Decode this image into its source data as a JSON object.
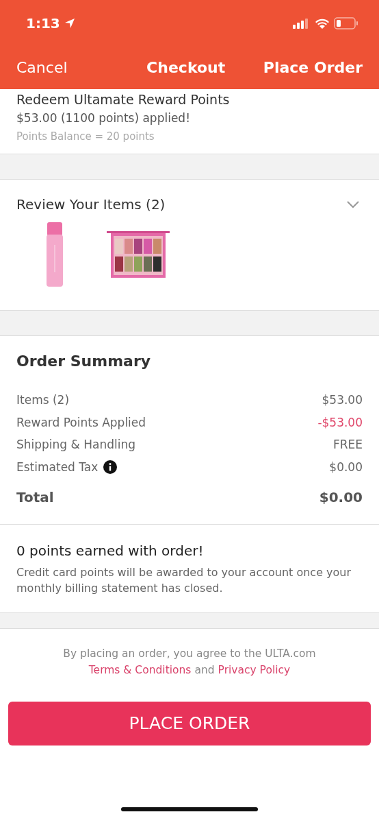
{
  "status_bar": {
    "time": "1:13"
  },
  "nav": {
    "left": "Cancel",
    "title": "Checkout",
    "right": "Place Order"
  },
  "rewards": {
    "title": "Redeem Ultamate Reward Points",
    "applied": "$53.00 (1100 points) applied!",
    "balance": "Points Balance = 20 points"
  },
  "review": {
    "title": "Review Your Items (2)",
    "expanded": false
  },
  "summary": {
    "title": "Order Summary",
    "rows": [
      {
        "label": "Items (2)",
        "value": "$53.00",
        "kind": "plain",
        "info": false
      },
      {
        "label": "Reward Points Applied",
        "value": "-$53.00",
        "kind": "discount",
        "info": false
      },
      {
        "label": "Shipping & Handling",
        "value": "FREE",
        "kind": "plain",
        "info": false
      },
      {
        "label": "Estimated Tax",
        "value": "$0.00",
        "kind": "plain",
        "info": true
      }
    ],
    "total_label": "Total",
    "total_value": "$0.00"
  },
  "points": {
    "title": "0 points earned with order!",
    "note": "Credit card points will be awarded to your account once your monthly billing statement has closed."
  },
  "terms": {
    "text": "By placing an order, you agree to the ULTA.com",
    "link1": "Terms & Conditions",
    "and": "and",
    "link2": "Privacy Policy"
  },
  "button": "PLACE ORDER"
}
